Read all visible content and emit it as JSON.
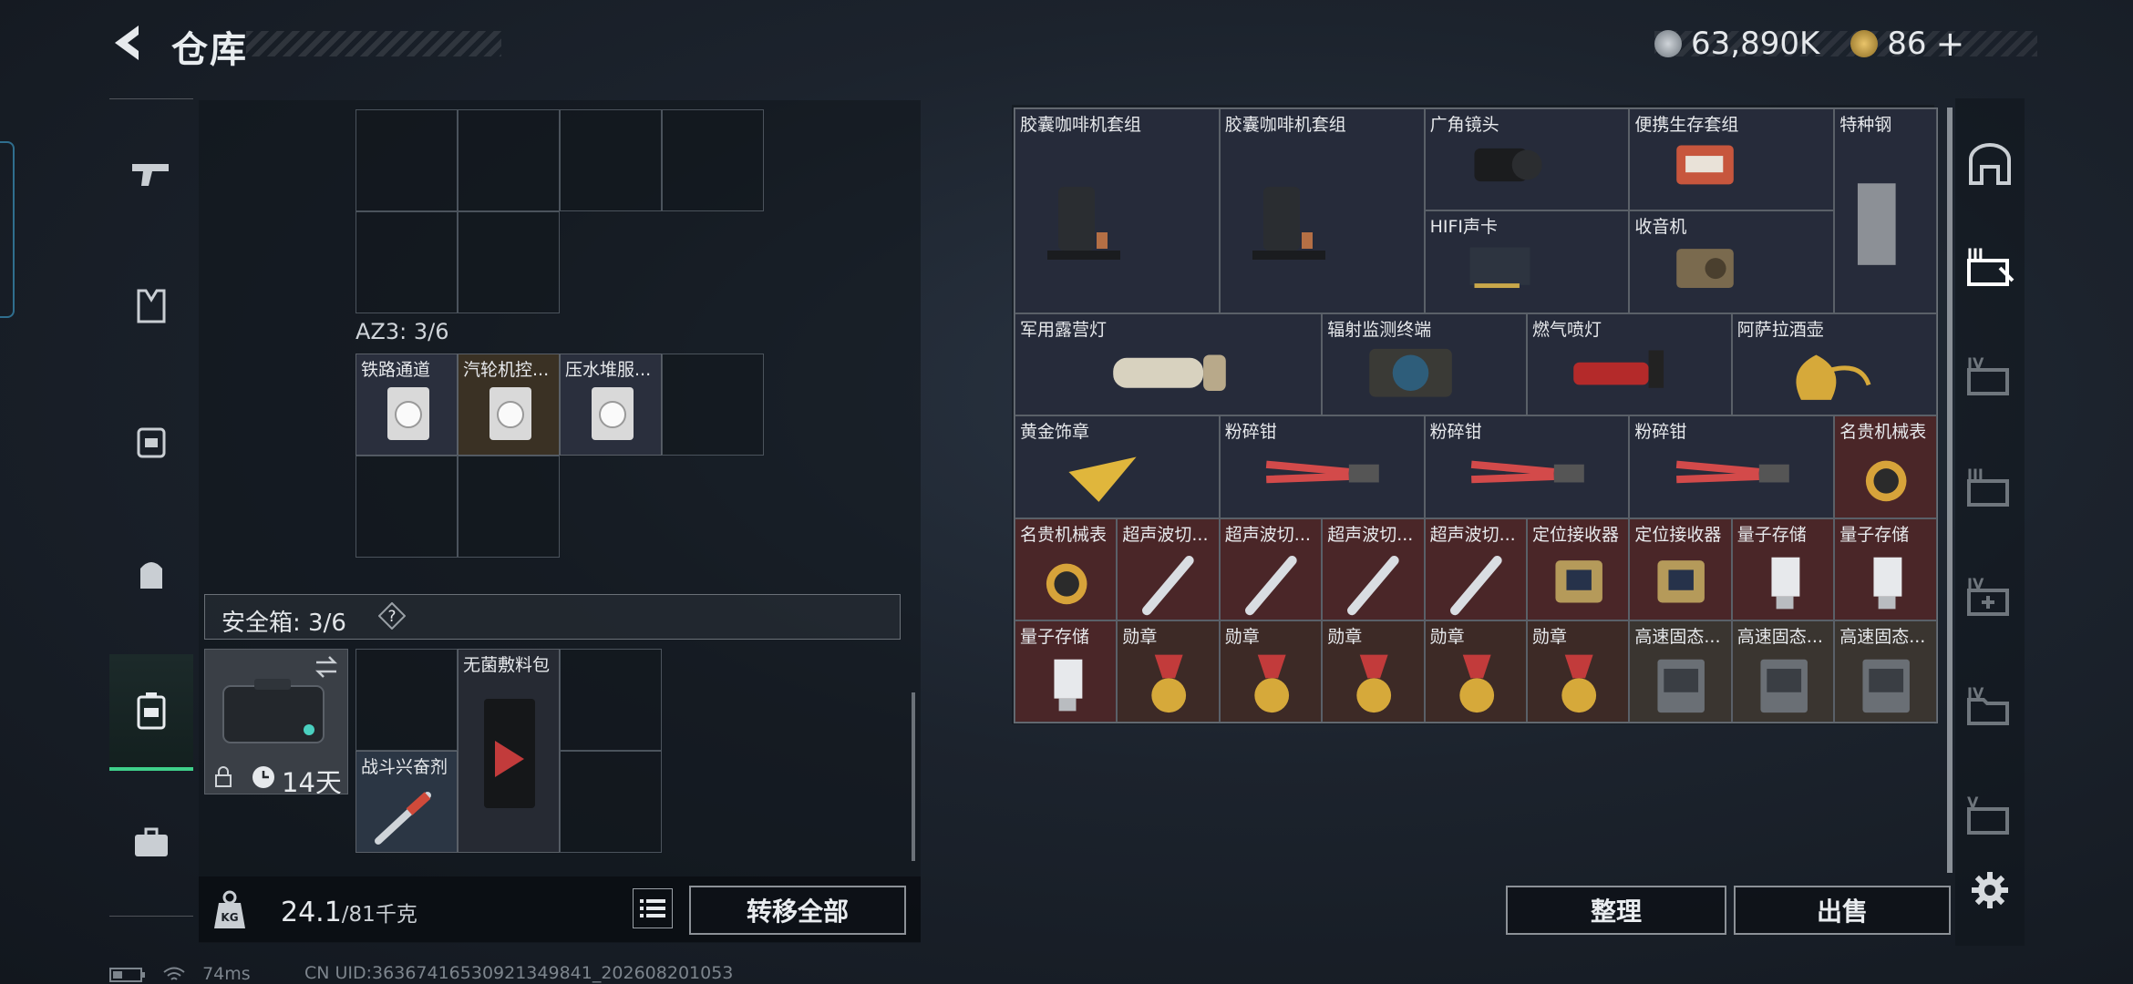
{
  "header": {
    "title": "仓库",
    "coins": "63,890K",
    "tokens": "86",
    "plus": "+"
  },
  "rail": {
    "items": [
      "pistol-icon",
      "vest-icon",
      "armor-icon",
      "backpack-icon",
      "safebox-icon",
      "briefcase-icon"
    ],
    "active_index": 4
  },
  "left": {
    "az3_label": "AZ3: 3/6",
    "az3_items": [
      "铁路通道",
      "汽轮机控...",
      "压水堆服..."
    ],
    "safebox_label": "安全箱: 3/6",
    "safebox_help": "?",
    "safebox_timer": "14天",
    "safebox_items": {
      "bandage": "无菌敷料包",
      "stim": "战斗兴奋剂"
    },
    "weight_value": "24.1",
    "weight_max": "/81千克",
    "transfer_all": "转移全部"
  },
  "stash": {
    "items": [
      {
        "label": "胶囊咖啡机套组",
        "bg": "#262b3a",
        "icon": "coffee-machine-icon"
      },
      {
        "label": "胶囊咖啡机套组",
        "bg": "#262b3a",
        "icon": "coffee-machine-icon"
      },
      {
        "label": "广角镜头",
        "bg": "#262b3a",
        "icon": "lens-icon"
      },
      {
        "label": "便携生存套组",
        "bg": "#262b3a",
        "icon": "survival-kit-icon"
      },
      {
        "label": "特种钢",
        "bg": "#262b3a",
        "icon": "steel-bar-icon"
      },
      {
        "label": "HIFI声卡",
        "bg": "#262b3a",
        "icon": "sound-card-icon"
      },
      {
        "label": "收音机",
        "bg": "#262b3a",
        "icon": "radio-icon"
      },
      {
        "label": "军用露营灯",
        "bg": "#262b3a",
        "icon": "lantern-icon"
      },
      {
        "label": "辐射监测终端",
        "bg": "#262b3a",
        "icon": "radiation-terminal-icon"
      },
      {
        "label": "燃气喷灯",
        "bg": "#262b3a",
        "icon": "torch-icon"
      },
      {
        "label": "阿萨拉酒壶",
        "bg": "#262b3a",
        "icon": "gold-pot-icon"
      },
      {
        "label": "黄金饰章",
        "bg": "#262b3a",
        "icon": "gold-emblem-icon"
      },
      {
        "label": "粉碎钳",
        "bg": "#262b3a",
        "icon": "pliers-icon"
      },
      {
        "label": "粉碎钳",
        "bg": "#262b3a",
        "icon": "pliers-icon"
      },
      {
        "label": "粉碎钳",
        "bg": "#262b3a",
        "icon": "pliers-icon"
      },
      {
        "label": "名贵机械表",
        "bg": "#4a2628",
        "icon": "watch-icon"
      },
      {
        "label": "名贵机械表",
        "bg": "#4a2628",
        "icon": "watch-icon"
      },
      {
        "label": "超声波切...",
        "bg": "#4a2628",
        "icon": "cutter-icon"
      },
      {
        "label": "超声波切...",
        "bg": "#4a2628",
        "icon": "cutter-icon"
      },
      {
        "label": "超声波切...",
        "bg": "#4a2628",
        "icon": "cutter-icon"
      },
      {
        "label": "超声波切...",
        "bg": "#4a2628",
        "icon": "cutter-icon"
      },
      {
        "label": "定位接收器",
        "bg": "#4a2628",
        "icon": "receiver-icon"
      },
      {
        "label": "定位接收器",
        "bg": "#4a2628",
        "icon": "receiver-icon"
      },
      {
        "label": "量子存储",
        "bg": "#4a2628",
        "icon": "usb-icon"
      },
      {
        "label": "量子存储",
        "bg": "#4a2628",
        "icon": "usb-icon"
      },
      {
        "label": "量子存储",
        "bg": "#4a2628",
        "icon": "usb-icon"
      },
      {
        "label": "勋章",
        "bg": "#3d2a26",
        "icon": "medal-icon"
      },
      {
        "label": "勋章",
        "bg": "#3d2a26",
        "icon": "medal-icon"
      },
      {
        "label": "勋章",
        "bg": "#3d2a26",
        "icon": "medal-icon"
      },
      {
        "label": "勋章",
        "bg": "#3d2a26",
        "icon": "medal-icon"
      },
      {
        "label": "勋章",
        "bg": "#3d2a26",
        "icon": "medal-icon"
      },
      {
        "label": "高速固态...",
        "bg": "#3a3530",
        "icon": "ssd-icon"
      },
      {
        "label": "高速固态...",
        "bg": "#3a3530",
        "icon": "ssd-icon"
      },
      {
        "label": "高速固态...",
        "bg": "#3a3530",
        "icon": "ssd-icon"
      }
    ],
    "sort_label": "整理",
    "sell_label": "出售"
  },
  "right_rail": {
    "tabs": [
      "III",
      "IV",
      "III",
      "IV",
      "IV",
      "V"
    ]
  },
  "status": {
    "ping": "74ms",
    "uid": "CN UID:3636741653092134984​1_202608201053"
  },
  "colors": {
    "accent_green": "#3fd08a",
    "rare_red": "#4a2628",
    "epic_purple": "#262b3a"
  }
}
